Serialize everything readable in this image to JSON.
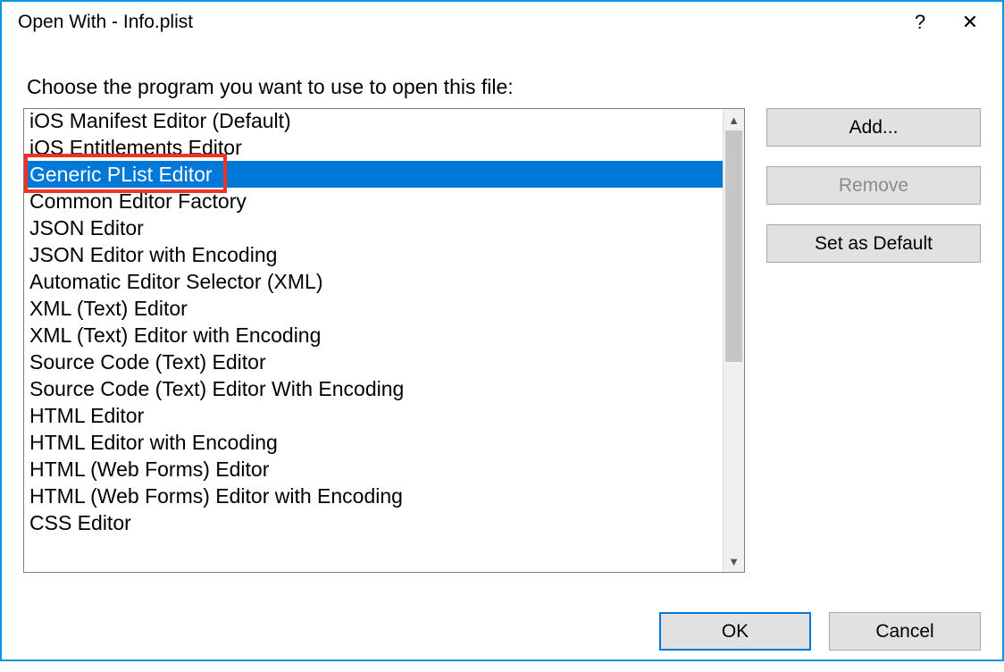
{
  "window": {
    "title": "Open With - Info.plist",
    "help_glyph": "?",
    "close_glyph": "✕"
  },
  "prompt": "Choose the program you want to use to open this file:",
  "list": {
    "selected_index": 2,
    "items": [
      "iOS Manifest Editor (Default)",
      "iOS Entitlements Editor",
      "Generic PList Editor",
      "Common Editor Factory",
      "JSON Editor",
      "JSON Editor with Encoding",
      "Automatic Editor Selector (XML)",
      "XML (Text) Editor",
      "XML (Text) Editor with Encoding",
      "Source Code (Text) Editor",
      "Source Code (Text) Editor With Encoding",
      "HTML Editor",
      "HTML Editor with Encoding",
      "HTML (Web Forms) Editor",
      "HTML (Web Forms) Editor with Encoding",
      "CSS Editor"
    ]
  },
  "buttons": {
    "add": "Add...",
    "remove": "Remove",
    "set_default": "Set as Default",
    "ok": "OK",
    "cancel": "Cancel"
  },
  "scroll": {
    "up_glyph": "▲",
    "down_glyph": "▼"
  }
}
